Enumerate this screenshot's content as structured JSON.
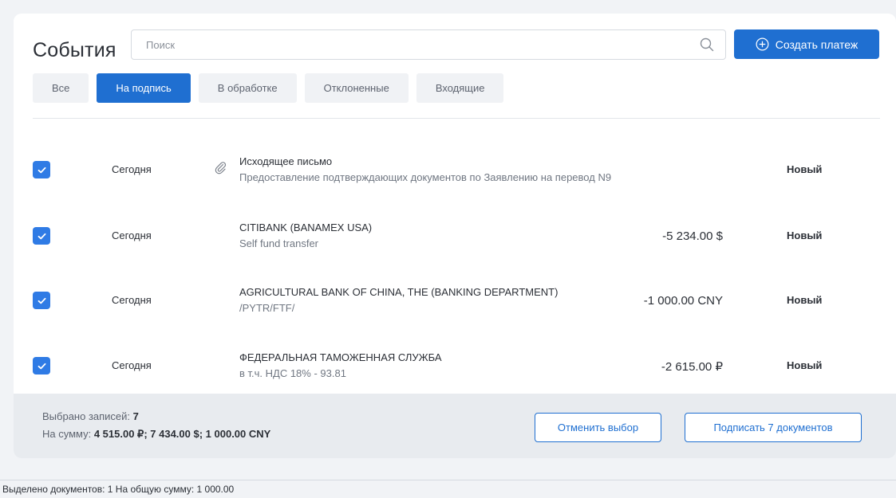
{
  "header": {
    "title": "События",
    "search_placeholder": "Поиск",
    "create_label": "Создать платеж"
  },
  "tabs": [
    {
      "label": "Все",
      "active": false
    },
    {
      "label": "На подпись",
      "active": true
    },
    {
      "label": "В обработке",
      "active": false
    },
    {
      "label": "Отклоненные",
      "active": false
    },
    {
      "label": "Входящие",
      "active": false
    }
  ],
  "rows": [
    {
      "checked": true,
      "date": "Сегодня",
      "attachment": true,
      "title": "Исходящее письмо",
      "subtitle": "Предоставление подтверждающих документов по Заявлению на перевод N9",
      "amount": "",
      "status": "Новый"
    },
    {
      "checked": true,
      "date": "Сегодня",
      "attachment": false,
      "title": "CITIBANK (BANAMEX USA)",
      "subtitle": "Self fund transfer",
      "amount": "-5 234.00 $",
      "status": "Новый"
    },
    {
      "checked": true,
      "date": "Сегодня",
      "attachment": false,
      "title": "AGRICULTURAL BANK OF CHINA, THE (BANKING DEPARTMENT)",
      "subtitle": "/PYTR/FTF/",
      "amount": "-1 000.00 CNY",
      "status": "Новый"
    },
    {
      "checked": true,
      "date": "Сегодня",
      "attachment": false,
      "title": "ФЕДЕРАЛЬНАЯ ТАМОЖЕННАЯ СЛУЖБА",
      "subtitle": "в т.ч. НДС 18% - 93.81",
      "amount": "-2 615.00 ₽",
      "status": "Новый"
    }
  ],
  "footer": {
    "selected_label": "Выбрано записей:",
    "selected_count": "7",
    "sum_label": "На сумму:",
    "sum_value": "4 515.00 ₽; 7 434.00 $; 1 000.00 CNY",
    "cancel_label": "Отменить выбор",
    "sign_label": "Подписать 7 документов"
  },
  "statusbar": {
    "text": "Выделено документов: 1 На общую сумму: 1 000.00"
  },
  "colors": {
    "accent": "#1f6fd1",
    "checkbox": "#2f7be5",
    "footer_bg": "#e8ebef"
  }
}
